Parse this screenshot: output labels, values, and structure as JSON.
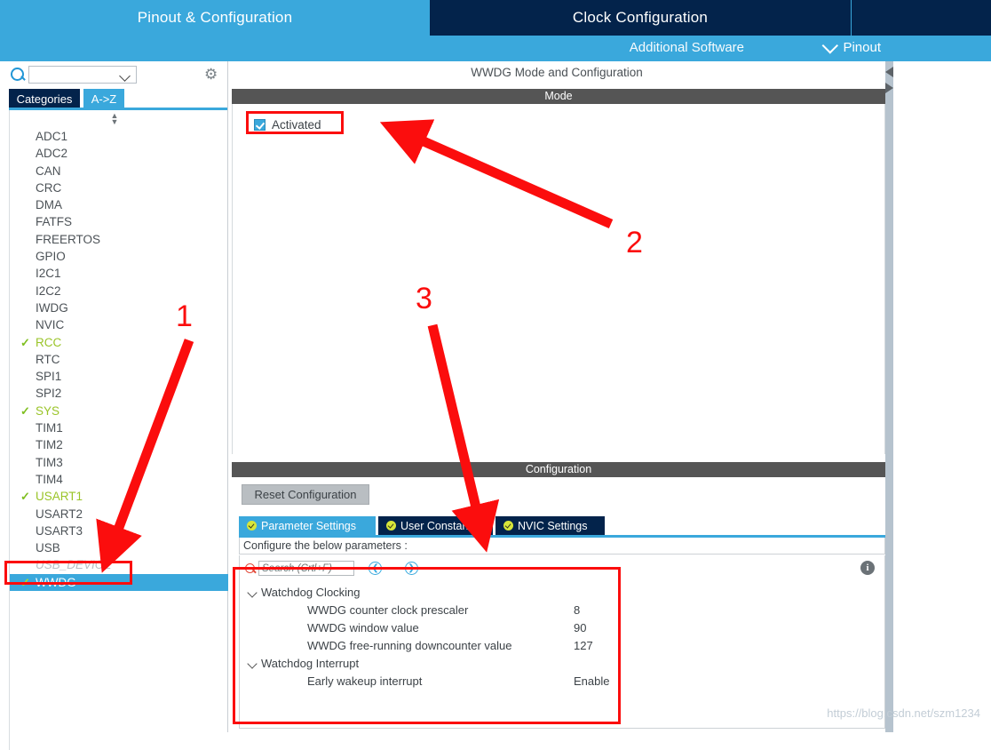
{
  "topbar": {
    "tabs": [
      {
        "label": "Pinout & Configuration",
        "active": true
      },
      {
        "label": "Clock Configuration",
        "active": false
      },
      {
        "label": "",
        "active": false
      }
    ],
    "additional_software": "Additional Software",
    "pinout_dropdown": "Pinout",
    "colors": {
      "accent_blue": "#3aa8dc",
      "navy": "#03234b"
    }
  },
  "sidebar": {
    "search_placeholder": "",
    "search_value": "",
    "gear_icon": "gear-icon",
    "tabs": [
      {
        "label": "Categories",
        "active": false
      },
      {
        "label": "A->Z",
        "active": true
      }
    ],
    "items": [
      {
        "label": "ADC1",
        "state": "normal"
      },
      {
        "label": "ADC2",
        "state": "normal"
      },
      {
        "label": "CAN",
        "state": "normal"
      },
      {
        "label": "CRC",
        "state": "normal"
      },
      {
        "label": "DMA",
        "state": "normal"
      },
      {
        "label": "FATFS",
        "state": "normal"
      },
      {
        "label": "FREERTOS",
        "state": "normal"
      },
      {
        "label": "GPIO",
        "state": "normal"
      },
      {
        "label": "I2C1",
        "state": "normal"
      },
      {
        "label": "I2C2",
        "state": "normal"
      },
      {
        "label": "IWDG",
        "state": "normal"
      },
      {
        "label": "NVIC",
        "state": "normal"
      },
      {
        "label": "RCC",
        "state": "configured"
      },
      {
        "label": "RTC",
        "state": "normal"
      },
      {
        "label": "SPI1",
        "state": "normal"
      },
      {
        "label": "SPI2",
        "state": "normal"
      },
      {
        "label": "SYS",
        "state": "configured"
      },
      {
        "label": "TIM1",
        "state": "normal"
      },
      {
        "label": "TIM2",
        "state": "normal"
      },
      {
        "label": "TIM3",
        "state": "normal"
      },
      {
        "label": "TIM4",
        "state": "normal"
      },
      {
        "label": "USART1",
        "state": "configured"
      },
      {
        "label": "USART2",
        "state": "normal"
      },
      {
        "label": "USART3",
        "state": "normal"
      },
      {
        "label": "USB",
        "state": "normal"
      },
      {
        "label": "USB_DEVICE",
        "state": "disabled"
      },
      {
        "label": "WWDG",
        "state": "selected"
      }
    ]
  },
  "main": {
    "title": "WWDG Mode and Configuration",
    "mode": {
      "band_label": "Mode",
      "activated_label": "Activated",
      "activated_checked": true
    },
    "configuration": {
      "band_label": "Configuration",
      "reset_button": "Reset Configuration",
      "tabs": [
        {
          "label": "Parameter Settings",
          "active": true
        },
        {
          "label": "User Constants",
          "active": false
        },
        {
          "label": "NVIC Settings",
          "active": false
        }
      ],
      "note": "Configure the below parameters :",
      "search_placeholder": "Search (Crtl+F)",
      "search_value": "",
      "nav_prev_icon": "chevron-left-circle-icon",
      "nav_next_icon": "chevron-right-circle-icon",
      "info_icon": "info-icon",
      "groups": [
        {
          "label": "Watchdog Clocking",
          "rows": [
            {
              "name": "WWDG counter clock prescaler",
              "value": "8"
            },
            {
              "name": "WWDG window value",
              "value": "90"
            },
            {
              "name": "WWDG free-running downcounter value",
              "value": "127"
            }
          ]
        },
        {
          "label": "Watchdog Interrupt",
          "rows": [
            {
              "name": "Early wakeup interrupt",
              "value": "Enable"
            }
          ]
        }
      ]
    }
  },
  "annotations": {
    "color": "#fb0d0d",
    "markers": [
      {
        "label": "1"
      },
      {
        "label": "2"
      },
      {
        "label": "3"
      }
    ]
  },
  "watermark": "https://blog.csdn.net/szm1234"
}
